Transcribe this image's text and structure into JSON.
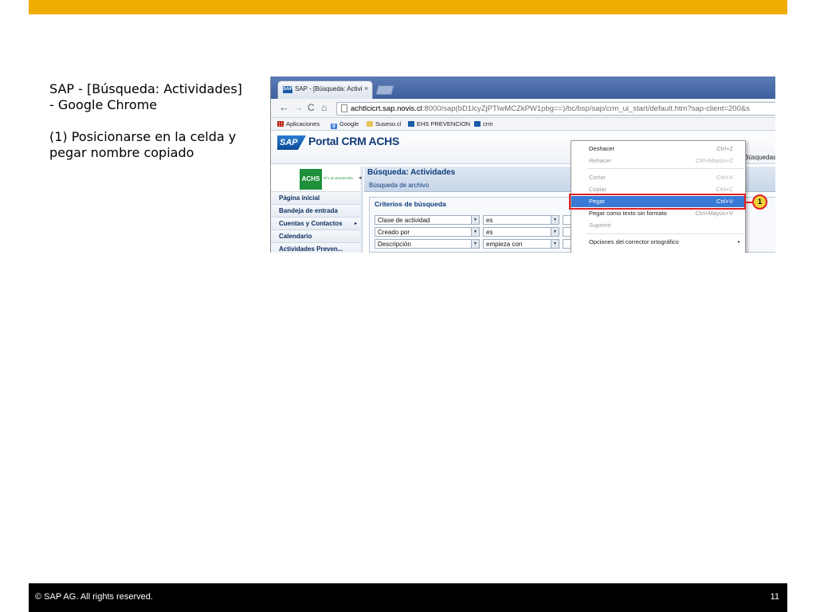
{
  "slide": {
    "title": "SAP - [Búsqueda: Actividades] - Google Chrome",
    "step": "(1) Posicionarse en la celda y pegar nombre copiado",
    "footer_copyright": "© SAP AG. All rights reserved.",
    "page_number": "11",
    "accent_color": "#f0ab00"
  },
  "browser": {
    "tab_title": "SAP - [Búsqueda: Activida",
    "tab_favicon": "SAP",
    "tab_close": "×",
    "address_host": "achtlcicrt.sap.novis.cl",
    "address_path": ":8000/sap(bD1lcyZjPTIwMCZkPW1pbg==)/bc/bsp/sap/crm_ui_start/default.htm?sap-client=200&s",
    "nav_back": "←",
    "nav_forward": "→",
    "nav_reload": "C",
    "nav_home": "⌂",
    "bookmarks": [
      {
        "label": "Aplicaciones",
        "icon": "apps-grid-icon"
      },
      {
        "label": "Google",
        "icon": "google-icon"
      },
      {
        "label": "Suseso.cl",
        "icon": "folder-icon"
      },
      {
        "label": "EHS PREVENCION",
        "icon": "sap-icon"
      },
      {
        "label": "crm",
        "icon": "sap-icon"
      }
    ]
  },
  "sap": {
    "logo": "SAP",
    "portal_title": "Portal CRM ACHS",
    "achs_logo": "ACHS",
    "achs_tagline": "Nº1 en prevención",
    "collapse_glyph": "◂",
    "searches_label": "Búsquedas",
    "sidebar": [
      {
        "label": "Página inicial",
        "has_arrow": false
      },
      {
        "label": "Bandeja de entrada",
        "has_arrow": false
      },
      {
        "label": "Cuentas y Contactos",
        "has_arrow": true,
        "arrow": "▸"
      },
      {
        "label": "Calendario",
        "has_arrow": false
      },
      {
        "label": "Actividades Preven...",
        "has_arrow": false
      }
    ],
    "page_title": "Búsqueda: Actividades",
    "page_subtitle": "Búsqueda de archivo",
    "criteria_title": "Criterios de búsqueda",
    "criteria_rows": [
      {
        "field": "Clase de actividad",
        "operator": "es"
      },
      {
        "field": "Creado por",
        "operator": "es"
      },
      {
        "field": "Descripción",
        "operator": "empieza con"
      }
    ],
    "dropdown_glyph": "▼"
  },
  "context_menu": {
    "items": [
      {
        "label": "Deshacer",
        "shortcut": "Ctrl+Z",
        "disabled": false
      },
      {
        "label": "Rehacer",
        "shortcut": "Ctrl+Mayús+Z",
        "disabled": true
      },
      {
        "label": "Cortar",
        "shortcut": "Ctrl+X",
        "disabled": true
      },
      {
        "label": "Copiar",
        "shortcut": "Ctrl+C",
        "disabled": true
      },
      {
        "label": "Pegar",
        "shortcut": "Ctrl+V",
        "disabled": false,
        "selected": true
      },
      {
        "label": "Pegar como texto sin formato",
        "shortcut": "Ctrl+Mayús+V",
        "disabled": false
      },
      {
        "label": "Suprimir",
        "shortcut": "",
        "disabled": true
      },
      {
        "label": "Opciones del corrector ortográfico",
        "shortcut": "",
        "submenu": "▸"
      }
    ],
    "selected_color": "#3a79d6",
    "callout_number": "1",
    "callout_color": "#e02020"
  }
}
